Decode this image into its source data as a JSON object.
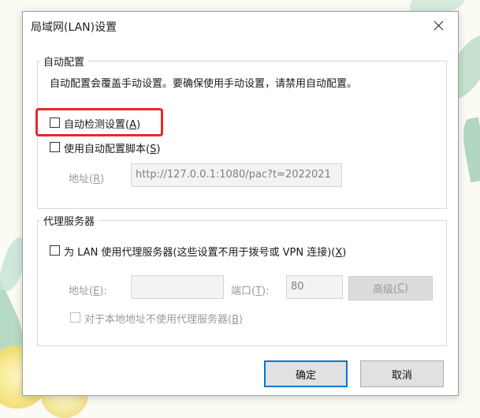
{
  "window": {
    "title": "局域网(LAN)设置"
  },
  "auto_config": {
    "group_label": "自动配置",
    "description": "自动配置会覆盖手动设置。要确保使用手动设置，请禁用自动配置。",
    "auto_detect": {
      "label": "自动检测设置(",
      "key": "A",
      "label_end": ")",
      "checked": false
    },
    "use_script": {
      "label": "使用自动配置脚本(",
      "key": "S",
      "label_end": ")",
      "checked": false
    },
    "address": {
      "label": "地址(",
      "key": "R",
      "label_end": ")",
      "value": "http://127.0.0.1:1080/pac?t=2022021"
    }
  },
  "proxy": {
    "group_label": "代理服务器",
    "use_proxy": {
      "label": "为 LAN 使用代理服务器(这些设置不用于拨号或 VPN 连接)(",
      "key": "X",
      "label_end": ")",
      "checked": false
    },
    "address": {
      "label": "地址(",
      "key": "E",
      "label_end": "):",
      "value": ""
    },
    "port": {
      "label": "端口(",
      "key": "T",
      "label_end": "):",
      "value": "80"
    },
    "advanced_button": {
      "label": "高级(",
      "key": "C",
      "label_end": ")"
    },
    "bypass_local": {
      "label": "对于本地地址不使用代理服务器(",
      "key": "B",
      "label_end": ")",
      "checked": false
    }
  },
  "buttons": {
    "ok": "确定",
    "cancel": "取消"
  },
  "colors": {
    "highlight": "#e32b2b",
    "background": "#fbfaf3"
  }
}
